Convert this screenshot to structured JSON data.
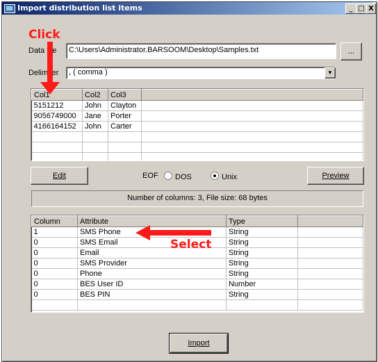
{
  "window": {
    "title": "Import distribution list items",
    "controls": {
      "minimize": "_",
      "maximize": "□",
      "close": "X"
    }
  },
  "data_file": {
    "label": "Data file",
    "value": "C:\\Users\\Administrator.BARSOOM\\Desktop\\Samples.txt",
    "browse_label": "..."
  },
  "delimiter": {
    "label": "Delimiter",
    "value": ", ( comma )"
  },
  "preview_table": {
    "columns": [
      "Col1",
      "Col2",
      "Col3",
      ""
    ],
    "rows": [
      [
        "5151212",
        "John",
        "Clayton",
        ""
      ],
      [
        "9056749000",
        "Jane",
        "Porter",
        ""
      ],
      [
        "4166164152",
        "John",
        "Carter",
        ""
      ],
      [
        "",
        "",
        "",
        ""
      ],
      [
        "",
        "",
        "",
        ""
      ],
      [
        "",
        "",
        "",
        ""
      ]
    ]
  },
  "controls": {
    "edit_label": "Edit",
    "eof_label": "EOF",
    "eof_options": [
      {
        "label": "DOS",
        "selected": false
      },
      {
        "label": "Unix",
        "selected": true
      }
    ],
    "preview_label": "Preview"
  },
  "status": {
    "text": "Number of columns: 3, File size: 68 bytes"
  },
  "mapping_table": {
    "columns": [
      "Column",
      "Attribute",
      "Type",
      ""
    ],
    "rows": [
      [
        "1",
        "SMS Phone",
        "String",
        ""
      ],
      [
        "0",
        "SMS Email",
        "String",
        ""
      ],
      [
        "0",
        "Email",
        "String",
        ""
      ],
      [
        "0",
        "SMS Provider",
        "String",
        ""
      ],
      [
        "0",
        "Phone",
        "String",
        ""
      ],
      [
        "0",
        "BES User ID",
        "Number",
        ""
      ],
      [
        "0",
        "BES PIN",
        "String",
        ""
      ],
      [
        "",
        "",
        "",
        ""
      ]
    ]
  },
  "import_label": "Import",
  "annotations": {
    "click": "Click",
    "select": "Select",
    "color": "#ff1a1a"
  }
}
